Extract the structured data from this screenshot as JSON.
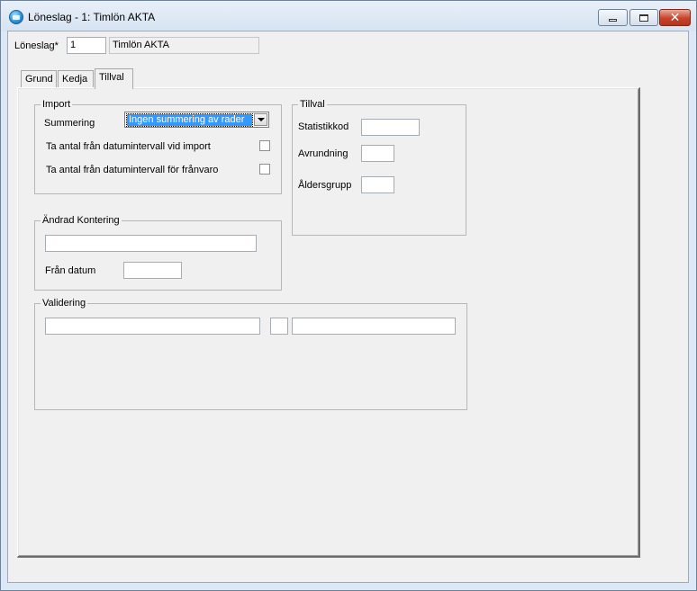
{
  "window": {
    "title": "Löneslag - 1: Timlön AKTA"
  },
  "header": {
    "label": "Löneslag*",
    "code": "1",
    "name": "Timlön AKTA"
  },
  "tabs": [
    {
      "label": "Grund"
    },
    {
      "label": "Kedja"
    },
    {
      "label": "Tillval"
    }
  ],
  "active_tab": "Tillval",
  "import": {
    "title": "Import",
    "summering_label": "Summering",
    "summering_value": "Ingen summering av rader",
    "checkbox1_label": "Ta antal från datumintervall vid import",
    "checkbox1_checked": false,
    "checkbox2_label": "Ta antal från datumintervall för frånvaro",
    "checkbox2_checked": false
  },
  "tillval": {
    "title": "Tillval",
    "statistikkod_label": "Statistikkod",
    "statistikkod_value": "",
    "avrundning_label": "Avrundning",
    "avrundning_value": "",
    "aldersgrupp_label": "Åldersgrupp",
    "aldersgrupp_value": ""
  },
  "andrad_kontering": {
    "title": "Ändrad Kontering",
    "kontering_value": "",
    "fran_datum_label": "Från datum",
    "fran_datum_value": ""
  },
  "validering": {
    "title": "Validering",
    "field1": "",
    "field2": "",
    "field3": ""
  },
  "colors": {
    "title_bar": "#dce8f5",
    "close_button": "#c7432b",
    "selection": "#3399ff",
    "panel": "#f0f0f0"
  }
}
